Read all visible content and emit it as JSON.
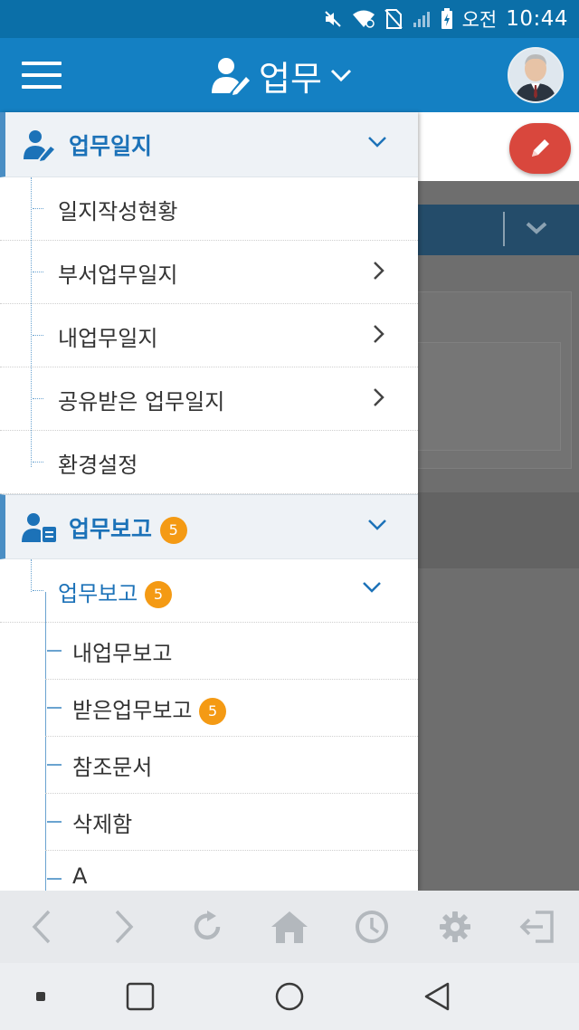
{
  "status_bar": {
    "ampm": "오전",
    "time": "10:44"
  },
  "app_bar": {
    "title": "업무"
  },
  "drawer": {
    "section1": {
      "label": "업무일지",
      "items": [
        {
          "label": "일지작성현황"
        },
        {
          "label": "부서업무일지"
        },
        {
          "label": "내업무일지"
        },
        {
          "label": "공유받은 업무일지"
        },
        {
          "label": "환경설정"
        }
      ]
    },
    "section2": {
      "label": "업무보고",
      "badge": "5",
      "sub": {
        "label": "업무보고",
        "badge": "5",
        "items": [
          {
            "label": "내업무보고"
          },
          {
            "label": "받은업무보고",
            "badge": "5"
          },
          {
            "label": "참조문서"
          },
          {
            "label": "삭제함"
          },
          {
            "label": "A"
          }
        ]
      }
    }
  },
  "colors": {
    "appbar": "#1480c3",
    "statusbar": "#0b6fa8",
    "accent": "#1c72b8",
    "badge": "#f49a14",
    "fab": "#d9473d"
  },
  "toolbar_icons": [
    "back-icon",
    "forward-icon",
    "refresh-icon",
    "home-icon",
    "history-icon",
    "settings-icon",
    "logout-icon"
  ],
  "nav_icons": [
    "recents-dot-icon",
    "square-icon",
    "circle-icon",
    "triangle-back-icon"
  ]
}
